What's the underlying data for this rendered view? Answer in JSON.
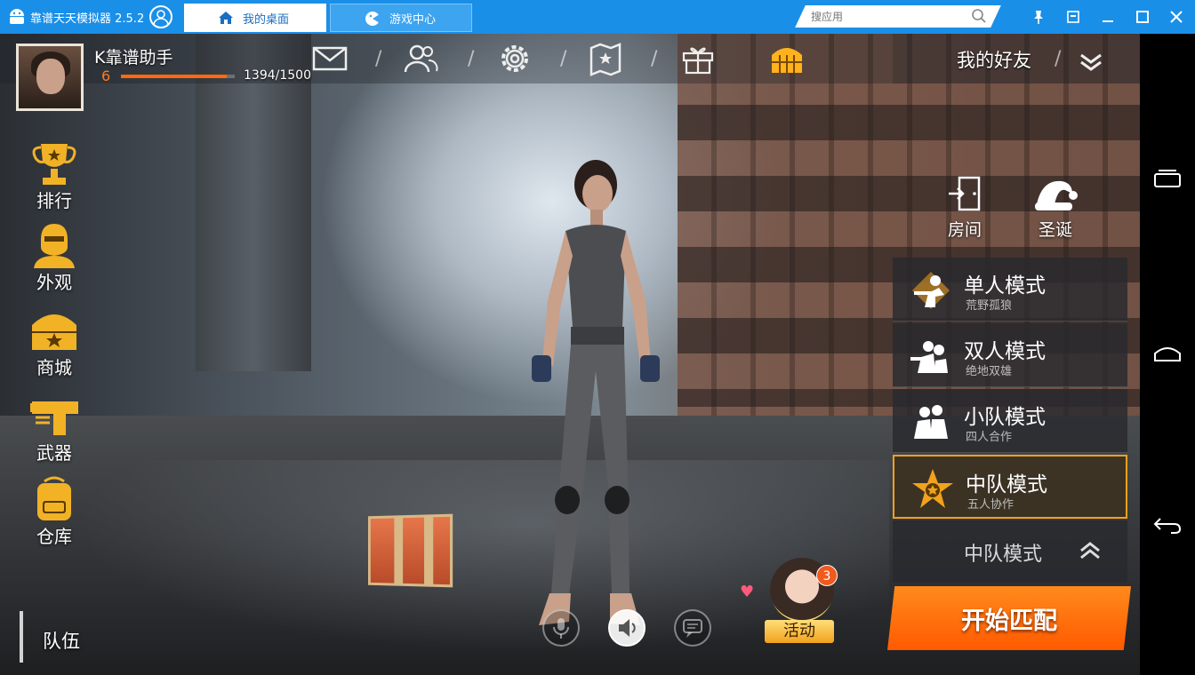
{
  "window": {
    "app_title": "靠谱天天模拟器 2.5.2",
    "tabs": [
      {
        "label": "我的桌面",
        "icon": "home-icon",
        "active": true
      },
      {
        "label": "游戏中心",
        "icon": "gamepad-icon",
        "active": false
      }
    ],
    "search": {
      "placeholder": "搜应用",
      "value": ""
    },
    "accent": "#1a8fe8"
  },
  "player": {
    "name": "K靠谱助手",
    "level": "6",
    "exp_text": "1394/1500",
    "exp_fraction": 0.93
  },
  "top_icons": [
    "mail-icon",
    "friends-group-icon",
    "settings-gear-icon",
    "map-icon",
    "gift-icon",
    "treasure-chest-icon"
  ],
  "friends": {
    "label": "我的好友"
  },
  "left_menu": [
    {
      "label": "排行",
      "icon": "trophy-icon"
    },
    {
      "label": "外观",
      "icon": "outfit-icon"
    },
    {
      "label": "商城",
      "icon": "shop-chest-icon"
    },
    {
      "label": "武器",
      "icon": "gun-icon"
    },
    {
      "label": "仓库",
      "icon": "backpack-icon"
    }
  ],
  "room": {
    "label": "房间"
  },
  "christmas": {
    "label": "圣诞"
  },
  "modes": [
    {
      "name": "单人模式",
      "sub": "荒野孤狼",
      "active": false
    },
    {
      "name": "双人模式",
      "sub": "绝地双雄",
      "active": false
    },
    {
      "name": "小队模式",
      "sub": "四人合作",
      "active": false
    },
    {
      "name": "中队模式",
      "sub": "五人协作",
      "active": true
    }
  ],
  "mode_selected": {
    "label": "中队模式"
  },
  "start_button": {
    "label": "开始匹配"
  },
  "team": {
    "label": "队伍"
  },
  "event": {
    "label": "活动",
    "badge": "3"
  },
  "brand_color": "#ff6a10"
}
